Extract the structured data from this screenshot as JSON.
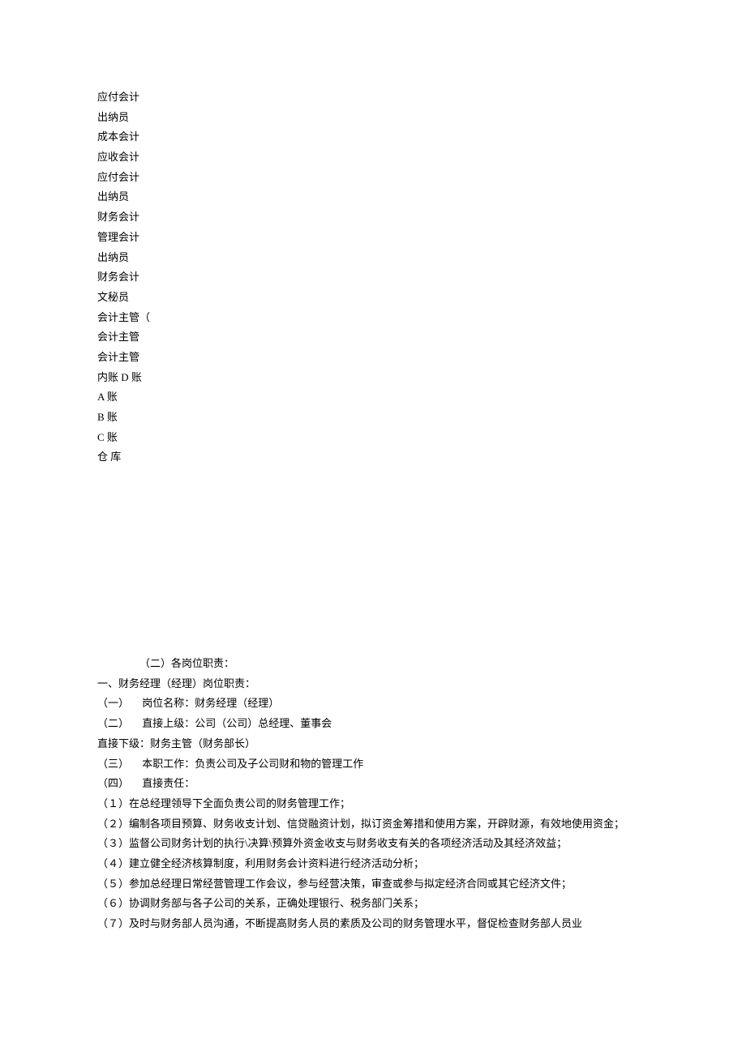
{
  "positions_list": [
    "应付会计",
    "出纳员",
    "成本会计",
    "应收会计",
    "应付会计",
    "出纳员",
    "财务会计",
    "管理会计",
    "出纳员",
    "财务会计",
    "文秘员",
    "会计主管（",
    "会计主管",
    "会计主管",
    "内账 D 账",
    "A 账",
    "B 账",
    "C 账",
    "仓 库"
  ],
  "section2_title": "（二）各岗位职责：",
  "item1_title": "一、财务经理（经理）岗位职责：",
  "sub1": "（一）   岗位名称：财务经理（经理）",
  "sub2": "（二）   直接上级：公司（公司）总经理、董事会",
  "sub2b": "直接下级：财务主管（财务部长）",
  "sub3": "（三）  本职工作：负责公司及子公司财和物的管理工作",
  "sub4": "（四）  直接责任：",
  "r1": "（１）在总经理领导下全面负责公司的财务管理工作；",
  "r2": "（２）编制各项目预算、财务收支计划、信贷融资计划，拟订资金筹措和使用方案，开辟财源，有效地使用资金；",
  "r3": "（３）监督公司财务计划的执行\\决算\\预算外资金收支与财务收支有关的各项经济活动及其经济效益；",
  "r4": "（４）建立健全经济核算制度，利用财务会计资料进行经济活动分析；",
  "r5": "（５）参加总经理日常经营管理工作会议，参与经营决策，审查或参与拟定经济合同或其它经济文件；",
  "r6": "（６）协调财务部与各子公司的关系，正确处理银行、税务部门关系；",
  "r7": "（７）及时与财务部人员沟通，不断提高财务人员的素质及公司的财务管理水平，督促检查财务部人员业"
}
